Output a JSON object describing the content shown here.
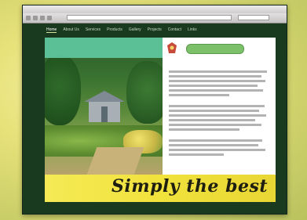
{
  "browser": {
    "title": "",
    "address": "",
    "search": ""
  },
  "nav": {
    "items": [
      "Home",
      "About Us",
      "Services",
      "Products",
      "Gallery",
      "Projects",
      "Contact",
      "Links"
    ]
  },
  "hero": {
    "banner_text": ""
  },
  "logo": {
    "name": ""
  },
  "content": {
    "heading": ""
  },
  "slogan": "Simply the best",
  "footer": {
    "links": [
      "",
      "",
      ""
    ]
  },
  "colors": {
    "window_frame": "#1f3b22",
    "banner": "#5fc9a0",
    "slogan_band": "#f1e23c",
    "logo_pill": "#7cc06a"
  }
}
